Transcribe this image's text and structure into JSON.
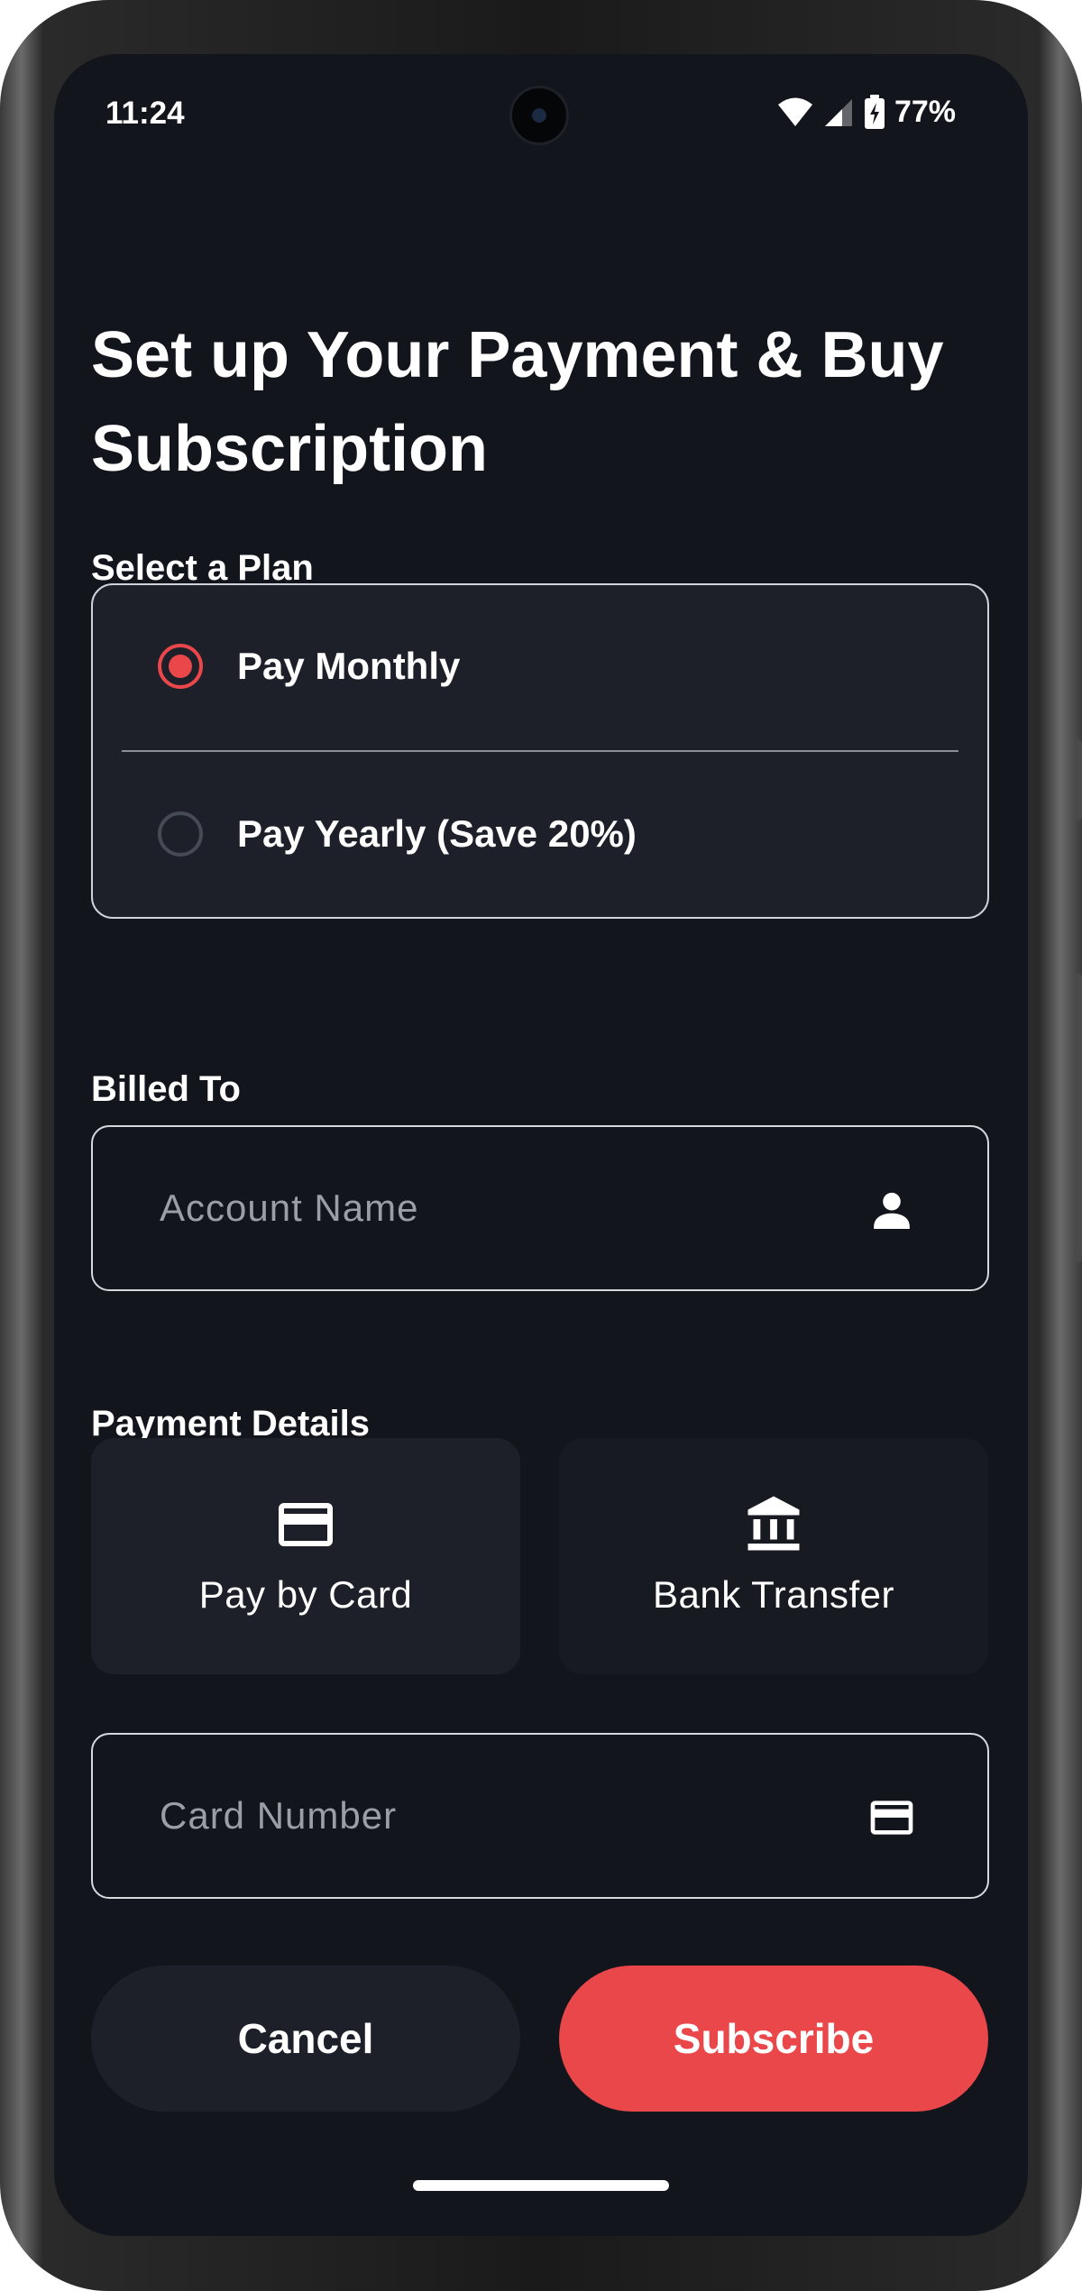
{
  "status_bar": {
    "time": "11:24",
    "battery_percent": "77%",
    "icons": [
      "wifi-icon",
      "signal-icon",
      "battery-charging-icon"
    ]
  },
  "page": {
    "title": "Set up Your Payment & Buy Subscription"
  },
  "plan_section": {
    "label": "Select a Plan",
    "options": [
      {
        "label": "Pay Monthly",
        "selected": true
      },
      {
        "label": "Pay Yearly (Save 20%)",
        "selected": false
      }
    ]
  },
  "billing_section": {
    "label": "Billed To",
    "account_name_placeholder": "Account Name",
    "account_name_value": "",
    "icon": "person-icon"
  },
  "payment_section": {
    "label": "Payment Details",
    "methods": [
      {
        "label": "Pay by Card",
        "icon": "credit-card-icon",
        "selected": true
      },
      {
        "label": "Bank Transfer",
        "icon": "bank-icon",
        "selected": false
      }
    ],
    "card_number_placeholder": "Card Number",
    "card_number_value": "",
    "card_icon": "credit-card-icon"
  },
  "actions": {
    "cancel_label": "Cancel",
    "subscribe_label": "Subscribe"
  },
  "colors": {
    "accent": "#EA474B",
    "background": "#12151C",
    "surface": "#1D2029"
  }
}
